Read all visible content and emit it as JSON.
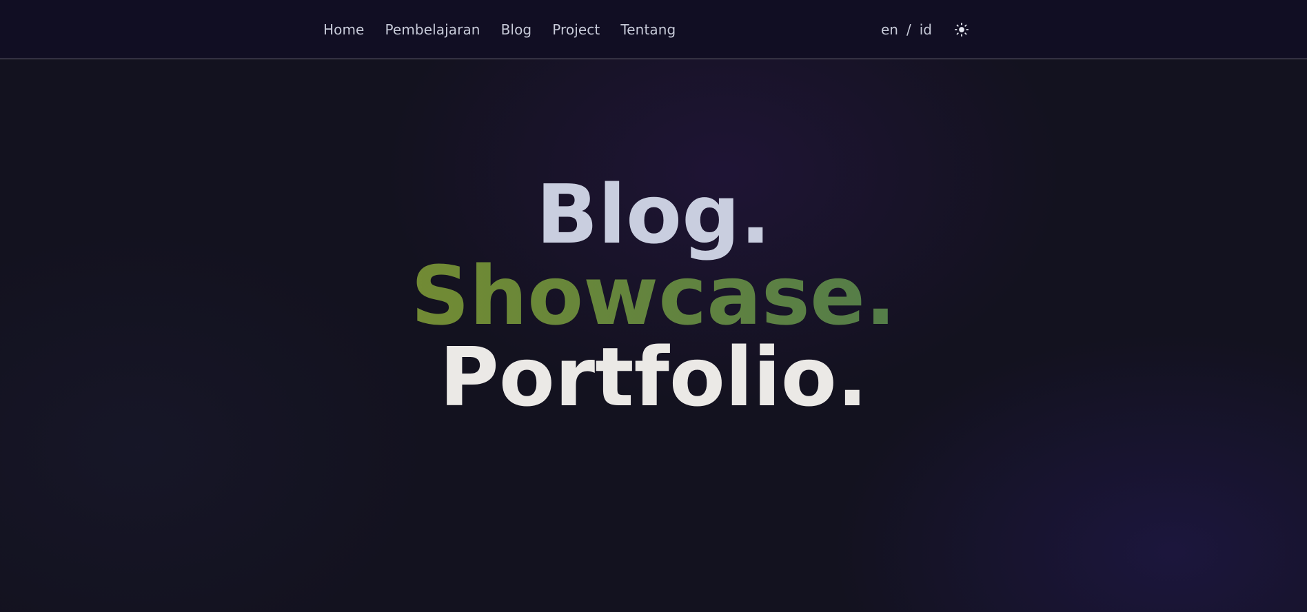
{
  "nav": {
    "links": [
      {
        "label": "Home"
      },
      {
        "label": "Pembelajaran"
      },
      {
        "label": "Blog"
      },
      {
        "label": "Project"
      },
      {
        "label": "Tentang"
      }
    ],
    "lang_en": "en",
    "lang_separator": "/",
    "lang_id": "id",
    "theme_icon": "sun-icon"
  },
  "hero": {
    "line1": "Blog.",
    "line2": "Showcase.",
    "line3": "Portfolio."
  },
  "colors": {
    "background": "#13121f",
    "navbar": "#110e23",
    "nav_text": "#c7cad8",
    "hero_line1": "#c9cedf",
    "hero_line2_start": "#8d9130",
    "hero_line2_end": "#3f7368",
    "hero_line3": "#ebe9e6"
  }
}
